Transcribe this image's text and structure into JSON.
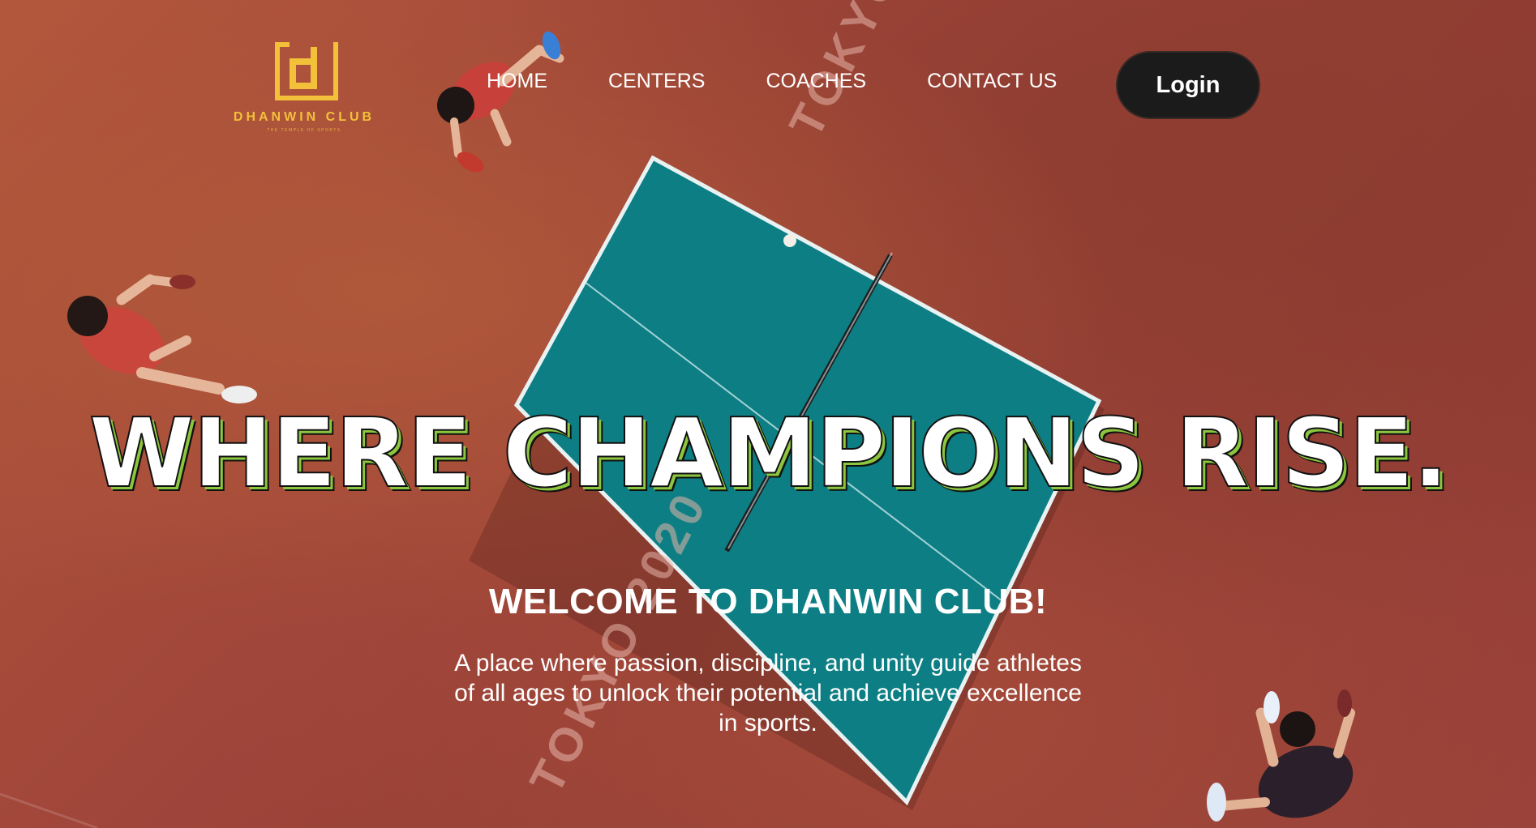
{
  "brand": {
    "name": "DHANWIN CLUB",
    "tagline": "THE TEMPLE OF SPORTS",
    "accent_color": "#f3c03a",
    "logo_icon": "dhanwin-d-monogram"
  },
  "nav": {
    "items": [
      {
        "label": "HOME"
      },
      {
        "label": "CENTERS"
      },
      {
        "label": "COACHES"
      },
      {
        "label": "CONTACT US"
      }
    ],
    "login_label": "Login"
  },
  "background": {
    "watermark_text": "TOKYO 2020",
    "floor_color": "#a8493a",
    "table_color": "#0d7f84"
  },
  "hero": {
    "headline": "WHERE CHAMPIONS RISE.",
    "headline_accent_color": "#8cc63f",
    "welcome": "WELCOME TO DHANWIN CLUB!",
    "description": "A place where passion, discipline, and unity guide athletes of all ages to unlock their potential and achieve excellence in sports."
  }
}
